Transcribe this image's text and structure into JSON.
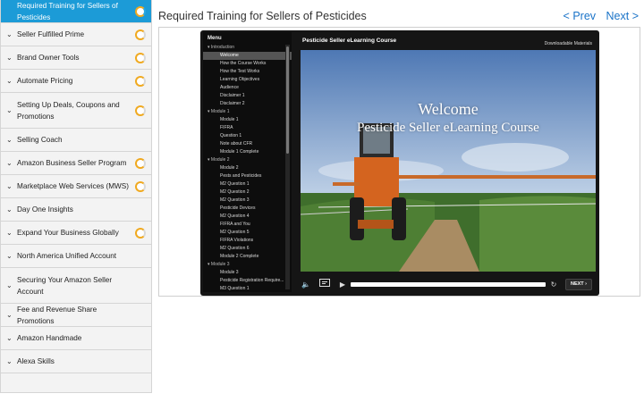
{
  "sidebar": {
    "items": [
      {
        "label": "Required Training for Sellers of Pesticides",
        "active": true,
        "progress": true
      },
      {
        "label": "Seller Fulfilled Prime",
        "active": false,
        "progress": true
      },
      {
        "label": "Brand Owner Tools",
        "active": false,
        "progress": true
      },
      {
        "label": "Automate Pricing",
        "active": false,
        "progress": true
      },
      {
        "label": "Setting Up Deals, Coupons and Promotions",
        "active": false,
        "progress": true
      },
      {
        "label": "Selling Coach",
        "active": false,
        "progress": false
      },
      {
        "label": "Amazon Business Seller Program",
        "active": false,
        "progress": true
      },
      {
        "label": "Marketplace Web Services (MWS)",
        "active": false,
        "progress": true
      },
      {
        "label": "Day One Insights",
        "active": false,
        "progress": false
      },
      {
        "label": "Expand Your Business Globally",
        "active": false,
        "progress": true
      },
      {
        "label": "North America Unified Account",
        "active": false,
        "progress": false
      },
      {
        "label": "Securing Your Amazon Seller Account",
        "active": false,
        "progress": false
      },
      {
        "label": "Fee and Revenue Share Promotions",
        "active": false,
        "progress": false
      },
      {
        "label": "Amazon Handmade",
        "active": false,
        "progress": false
      },
      {
        "label": "Alexa Skills",
        "active": false,
        "progress": false
      }
    ]
  },
  "header": {
    "title": "Required Training for Sellers of Pesticides",
    "prev_label": "< Prev",
    "next_label": "Next >"
  },
  "player": {
    "menu_title": "Menu",
    "course_title": "Pesticide Seller eLearning Course",
    "downloads_label": "Downloadable Materials",
    "menu": [
      {
        "label": "Introduction",
        "section": true
      },
      {
        "label": "Welcome",
        "current": true
      },
      {
        "label": "How the Course Works"
      },
      {
        "label": "How the Test Works"
      },
      {
        "label": "Learning Objectives"
      },
      {
        "label": "Audience"
      },
      {
        "label": "Disclaimer 1"
      },
      {
        "label": "Disclaimer 2"
      },
      {
        "label": "Module 1",
        "section": true
      },
      {
        "label": "Module 1"
      },
      {
        "label": "FIFRA"
      },
      {
        "label": "Question 1"
      },
      {
        "label": "Note about CFR"
      },
      {
        "label": "Module 1 Complete"
      },
      {
        "label": "Module 2",
        "section": true
      },
      {
        "label": "Module 2"
      },
      {
        "label": "Pests and Pesticides"
      },
      {
        "label": "M2 Question 1"
      },
      {
        "label": "M2 Question 2"
      },
      {
        "label": "M2 Question 3"
      },
      {
        "label": "Pesticide Devices"
      },
      {
        "label": "M2 Question 4"
      },
      {
        "label": "FIFRA and You"
      },
      {
        "label": "M2 Question 5"
      },
      {
        "label": "FIFRA Violations"
      },
      {
        "label": "M2 Question 6"
      },
      {
        "label": "Module 2 Complete"
      },
      {
        "label": "Module 3",
        "section": true
      },
      {
        "label": "Module 3"
      },
      {
        "label": "Pesticide Registration Require..."
      },
      {
        "label": "M3 Question 1"
      }
    ],
    "slide": {
      "line1": "Welcome",
      "line2": "Pesticide Seller eLearning Course"
    },
    "controls": {
      "next_label": "NEXT"
    }
  },
  "colors": {
    "accent": "#1c9bd7",
    "progress": "#f0a91f",
    "link": "#1a73c8"
  }
}
